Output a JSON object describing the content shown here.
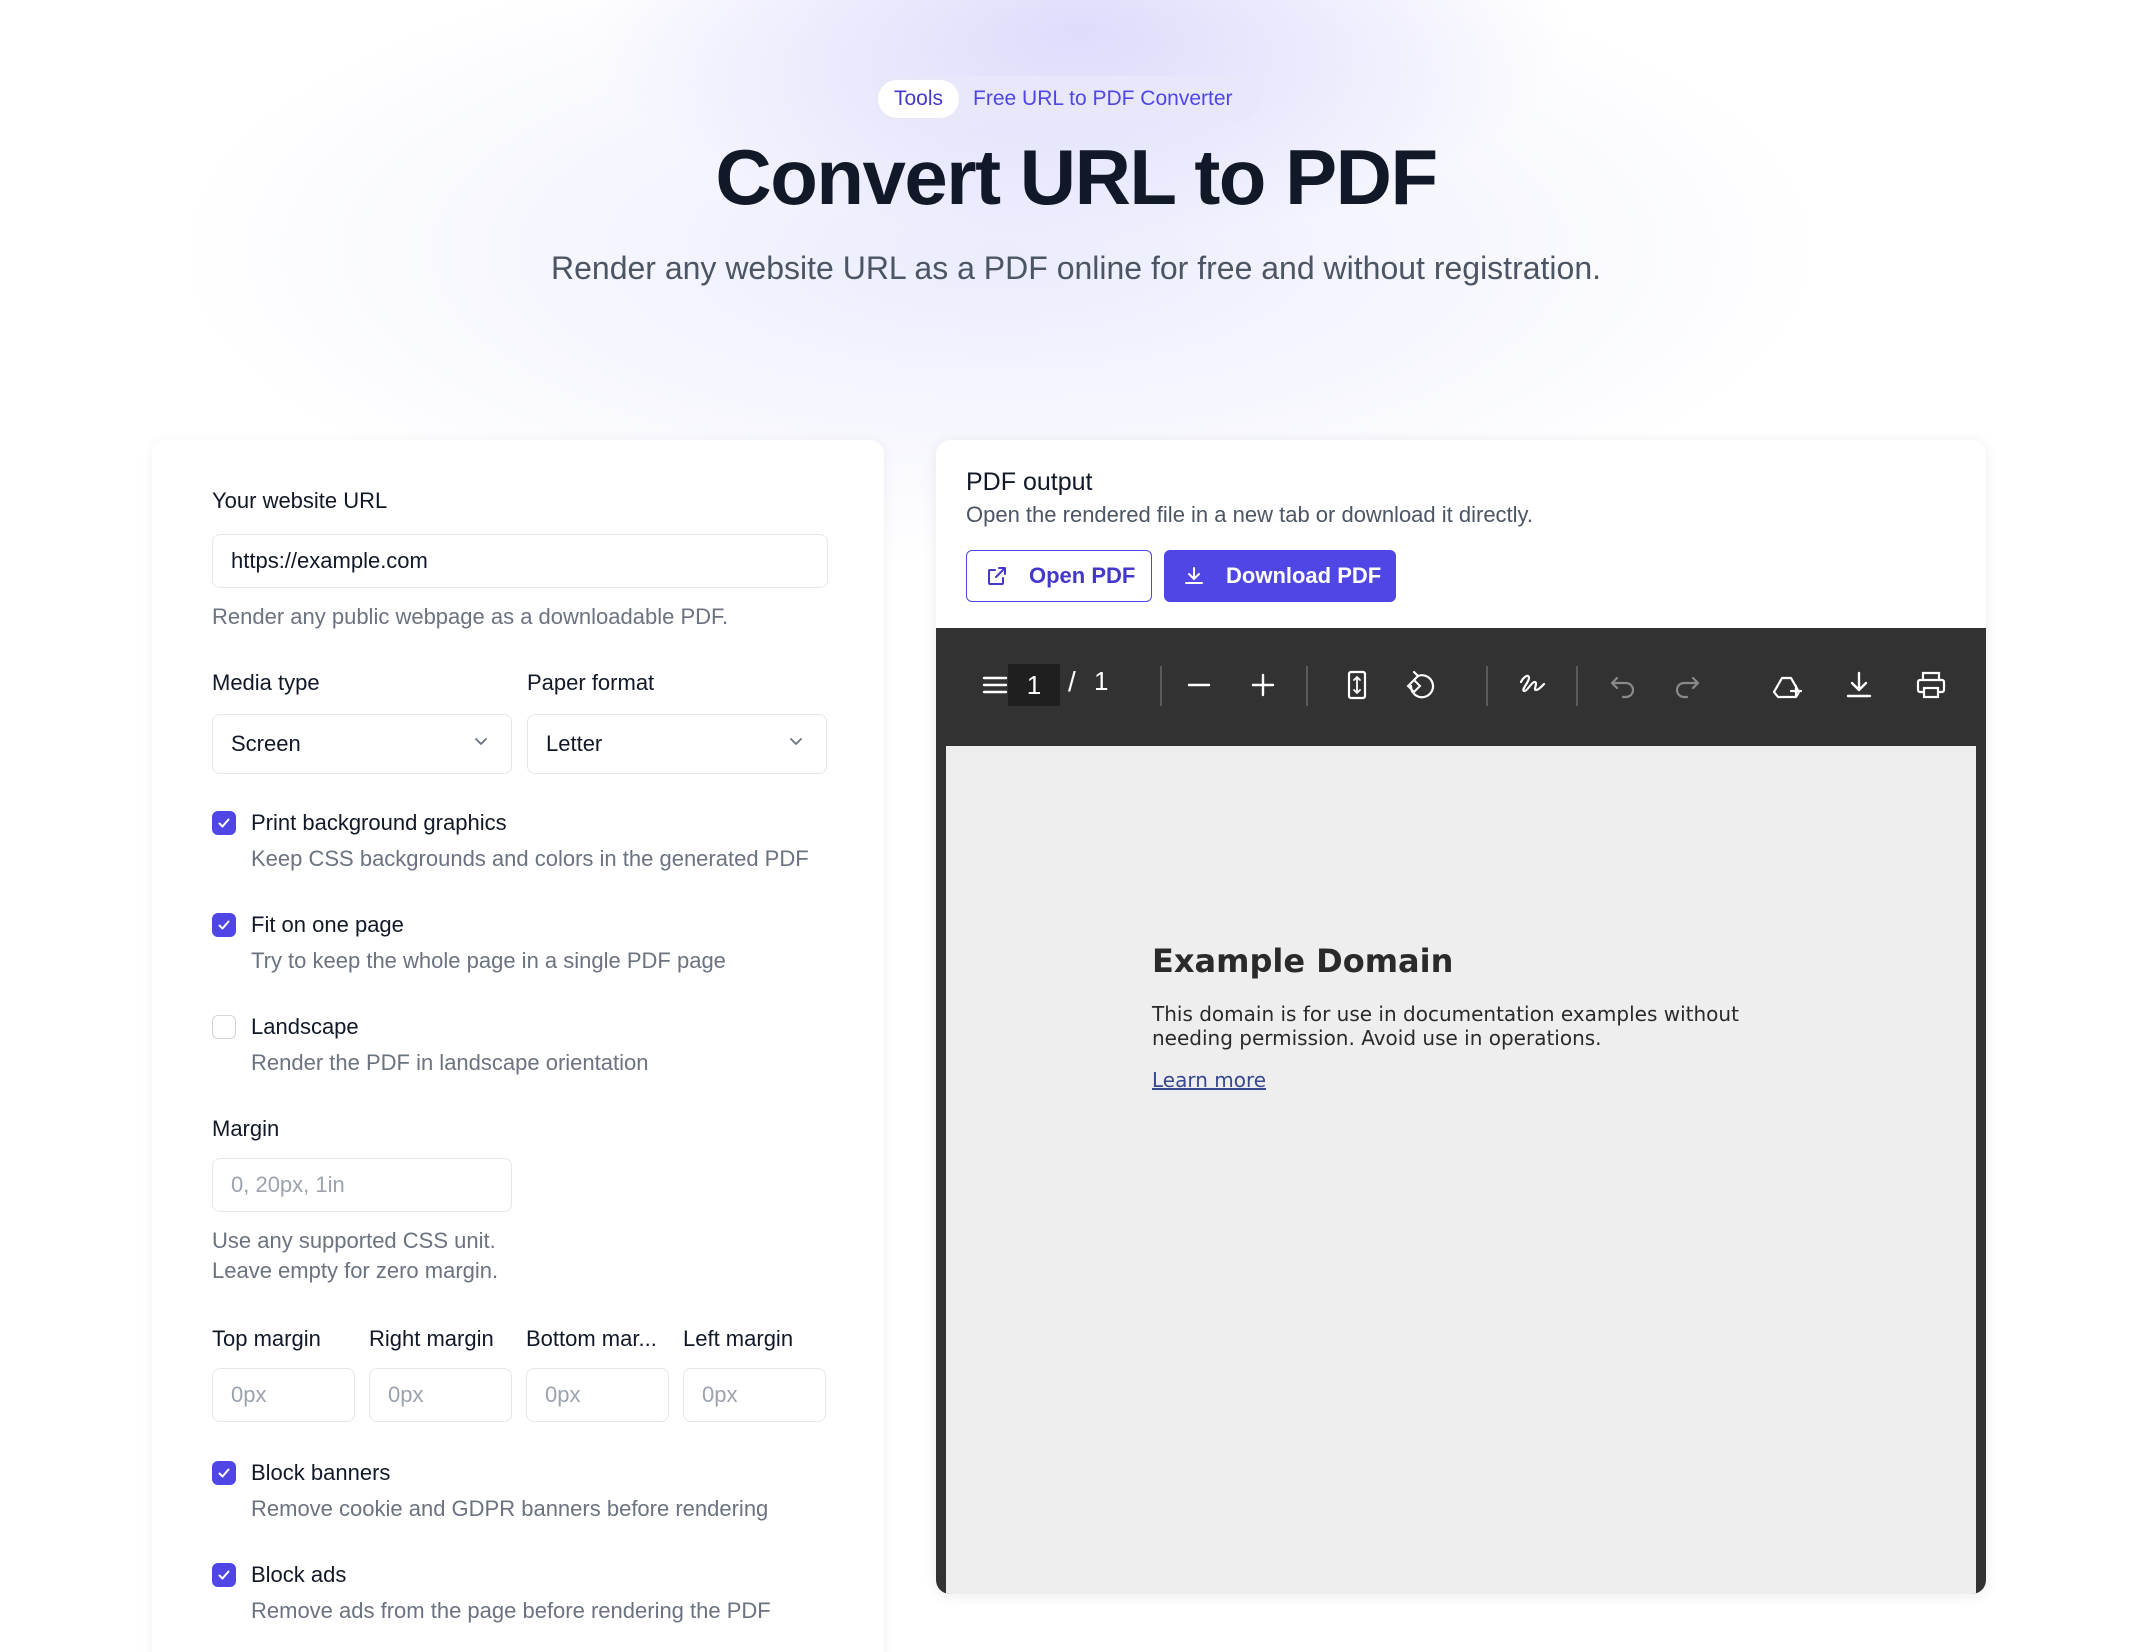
{
  "hero": {
    "badge_tag": "Tools",
    "badge_text": "Free URL to PDF Converter",
    "title": "Convert URL to PDF",
    "subtitle": "Render any website URL as a PDF online for free and without registration."
  },
  "form": {
    "url_label": "Your website URL",
    "url_value": "https://example.com",
    "url_hint": "Render any public webpage as a downloadable PDF.",
    "media_type_label": "Media type",
    "media_type_value": "Screen",
    "paper_format_label": "Paper format",
    "paper_format_value": "Letter",
    "options": [
      {
        "title": "Print background graphics",
        "desc": "Keep CSS backgrounds and colors in the generated PDF",
        "checked": true
      },
      {
        "title": "Fit on one page",
        "desc": "Try to keep the whole page in a single PDF page",
        "checked": true
      },
      {
        "title": "Landscape",
        "desc": "Render the PDF in landscape orientation",
        "checked": false
      }
    ],
    "margin_label": "Margin",
    "margin_placeholder": "0, 20px, 1in",
    "margin_hint_1": "Use any supported CSS unit.",
    "margin_hint_2": "Leave empty for zero margin.",
    "margins": [
      {
        "label": "Top margin",
        "placeholder": "0px"
      },
      {
        "label": "Right margin",
        "placeholder": "0px"
      },
      {
        "label": "Bottom mar...",
        "placeholder": "0px"
      },
      {
        "label": "Left margin",
        "placeholder": "0px"
      }
    ],
    "block_options": [
      {
        "title": "Block banners",
        "desc": "Remove cookie and GDPR banners before rendering",
        "checked": true
      },
      {
        "title": "Block ads",
        "desc": "Remove ads from the page before rendering the PDF",
        "checked": true
      }
    ]
  },
  "output": {
    "title": "PDF output",
    "desc": "Open the rendered file in a new tab or download it directly.",
    "open_label": "Open PDF",
    "download_label": "Download PDF"
  },
  "viewer": {
    "page_current": "1",
    "page_sep": "/",
    "page_total": "1",
    "doc_heading": "Example Domain",
    "doc_text": "This domain is for use in documentation examples without needing permission. Avoid use in operations.",
    "doc_link": "Learn more"
  },
  "colors": {
    "accent": "#4f46e5",
    "viewer_toolbar": "#323232",
    "pdf_page": "#eeeeee"
  }
}
